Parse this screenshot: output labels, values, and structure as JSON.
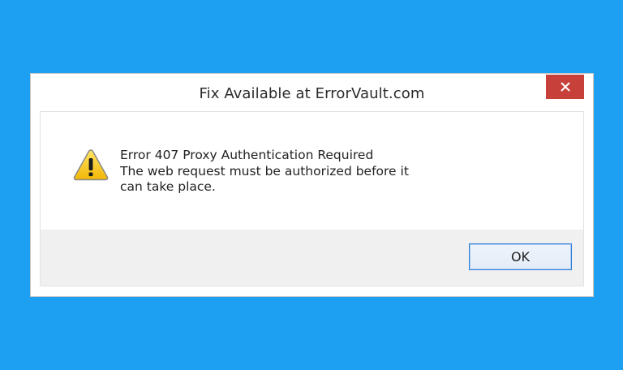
{
  "dialog": {
    "title": "Fix Available at ErrorVault.com",
    "close_icon": "close-icon",
    "warning_icon": "warning-triangle-icon",
    "message_lines": [
      "Error 407 Proxy Authentication Required",
      "The web request must be authorized before it",
      "can take place."
    ],
    "ok_label": "OK"
  },
  "colors": {
    "background": "#1ea0f2",
    "close_button": "#c7403a",
    "footer": "#f0f0f0",
    "ok_border": "#2f7ed8"
  }
}
